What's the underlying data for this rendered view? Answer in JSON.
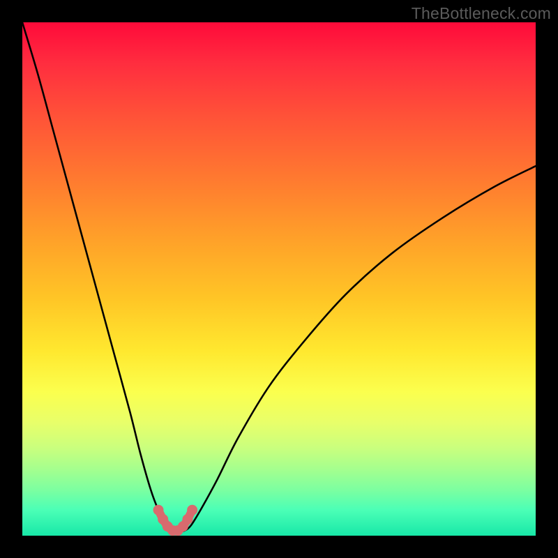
{
  "watermark": "TheBottleneck.com",
  "colors": {
    "frame": "#000000",
    "curve": "#000000",
    "marker_stroke": "#d86a6e",
    "marker_fill": "#d86a6e"
  },
  "chart_data": {
    "type": "line",
    "title": "",
    "xlabel": "",
    "ylabel": "",
    "xlim": [
      0,
      100
    ],
    "ylim": [
      0,
      100
    ],
    "grid": false,
    "legend": false,
    "series": [
      {
        "name": "bottleneck-curve",
        "x": [
          0,
          3,
          6,
          9,
          12,
          15,
          18,
          21,
          23,
          25,
          26.5,
          28,
          29,
          30,
          31,
          32,
          33,
          35,
          38,
          42,
          48,
          55,
          63,
          72,
          82,
          92,
          100
        ],
        "y": [
          100,
          90,
          79,
          68,
          57,
          46,
          35,
          24,
          16,
          9,
          5,
          2.2,
          1.2,
          0.8,
          0.8,
          1.2,
          2.2,
          5.5,
          11,
          19,
          29,
          38,
          47,
          55,
          62,
          68,
          72
        ]
      }
    ],
    "markers": {
      "name": "near-optimum-dots",
      "x": [
        26.5,
        27.4,
        28.3,
        29.3,
        30.3,
        31.3,
        32.2,
        33.1
      ],
      "y": [
        5.0,
        3.2,
        1.8,
        1.0,
        1.0,
        1.8,
        3.2,
        5.0
      ]
    }
  }
}
